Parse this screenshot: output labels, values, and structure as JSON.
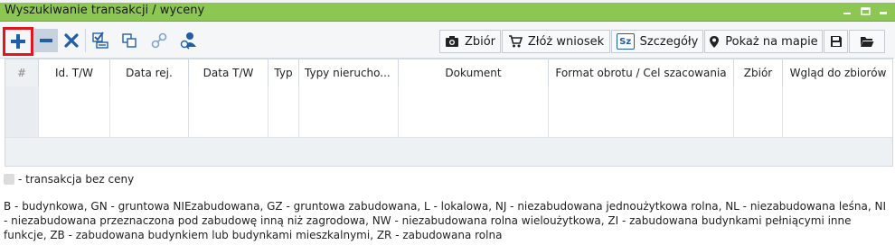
{
  "window": {
    "title": "Wyszukiwanie transakcji / wyceny"
  },
  "window_controls": [
    {
      "icon": "minimize-icon"
    },
    {
      "icon": "restore-icon"
    },
    {
      "icon": "close-icon"
    }
  ],
  "toolbar": {
    "icons": [
      "add-icon",
      "remove-icon",
      "delete-icon",
      "check-list-icon",
      "copy-icon",
      "link-icon",
      "locate-user-icon"
    ],
    "right_buttons": [
      {
        "label": "Zbiór",
        "icon": "camera-icon"
      },
      {
        "label": "Złóż wniosek",
        "icon": "cart-icon"
      },
      {
        "label": "Szczegóły",
        "icon": "details-icon",
        "icon_text": "Sz"
      },
      {
        "label": "Pokaż na mapie",
        "icon": "map-pin-icon"
      },
      {
        "label": "",
        "icon": "save-icon"
      },
      {
        "label": "",
        "icon": "open-folder-icon"
      }
    ]
  },
  "table": {
    "columns": [
      "#",
      "Id. T/W",
      "Data rej.",
      "Data T/W",
      "Typ",
      "Typy nierucho...",
      "Dokument",
      "Format obrotu / Cel szacowania",
      "Zbiór",
      "Wgląd do zbiorów"
    ],
    "rows": [
      [],
      [],
      [],
      []
    ]
  },
  "legend": {
    "text": "- transakcja bez ceny"
  },
  "abbreviations": "B - budynkowa, GN - gruntowa NIEzabudowana, GZ - gruntowa zabudowana, L - lokalowa, NJ - niezabudowana jednoużytkowa rolna, NL - niezabudowana leśna, NI - niezabudowana przeznaczona pod zabudowę inną niż zagrodowa, NW - niezabudowana rolna wieloużytkowa, ZI - zabudowana budynkami pełniącymi inne funkcje, ZB - zabudowana budynkiem lub budynkami mieszkalnymi, ZR - zabudowana rolna",
  "colors": {
    "titlebar": "#8cc653",
    "highlight": "#e3141b",
    "icon_blue": "#1f5ea8"
  }
}
